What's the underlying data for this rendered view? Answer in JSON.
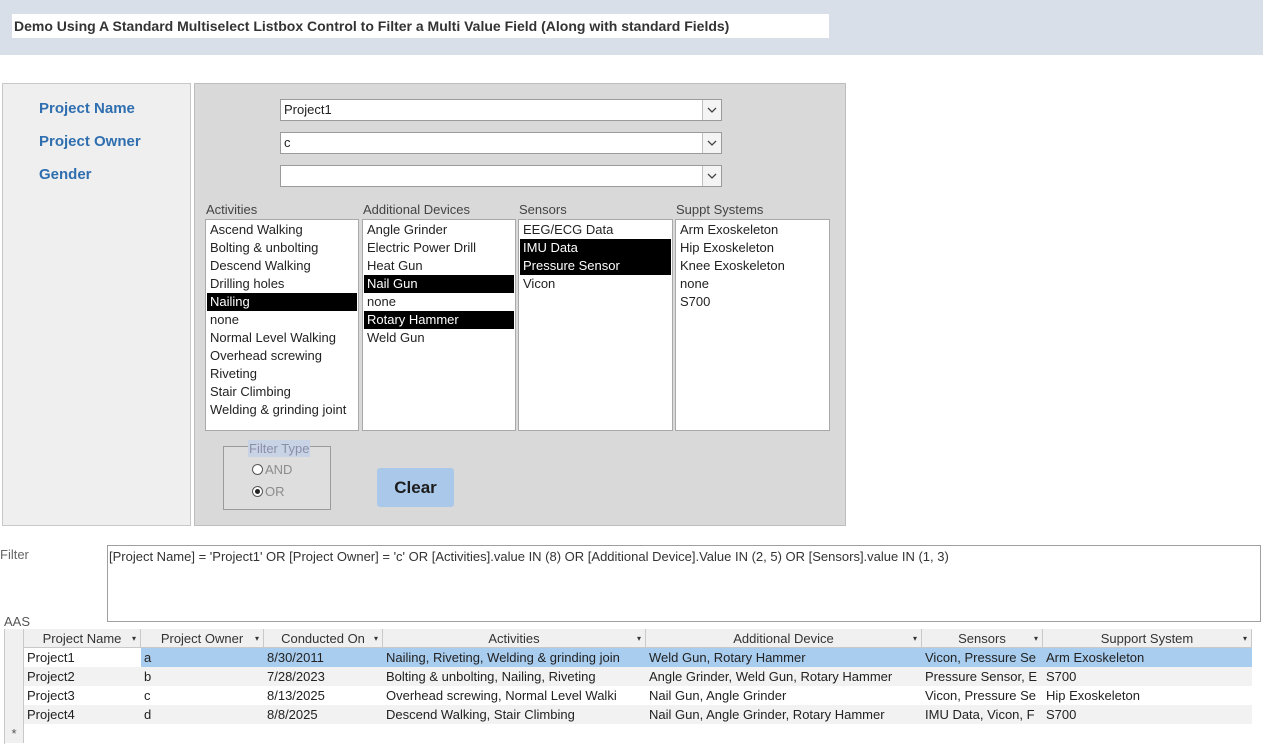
{
  "page_title": "Demo Using A Standard Multiselect Listbox Control to Filter a Multi Value Field (Along with standard Fields)",
  "fields": {
    "project_name_label": "Project Name",
    "project_owner_label": "Project Owner",
    "gender_label": "Gender",
    "project_name_value": "Project1",
    "project_owner_value": "c",
    "gender_value": ""
  },
  "lists": {
    "activities": {
      "caption": "Activities",
      "items": [
        "Ascend Walking",
        "Bolting & unbolting",
        "Descend Walking",
        "Drilling holes",
        "Nailing",
        "none",
        "Normal Level Walking",
        "Overhead screwing",
        "Riveting",
        "Stair Climbing",
        "Welding & grinding joint"
      ],
      "selected": [
        4
      ]
    },
    "devices": {
      "caption": "Additional Devices",
      "items": [
        "Angle Grinder",
        "Electric Power Drill",
        "Heat Gun",
        "Nail Gun",
        "none",
        "Rotary Hammer",
        "Weld Gun"
      ],
      "selected": [
        3,
        5
      ]
    },
    "sensors": {
      "caption": "Sensors",
      "items": [
        "EEG/ECG Data",
        "IMU Data",
        "Pressure Sensor",
        "Vicon"
      ],
      "selected": [
        1,
        2
      ]
    },
    "support": {
      "caption": "Suppt Systems",
      "items": [
        "Arm Exoskeleton",
        "Hip Exoskeleton",
        "Knee Exoskeleton",
        "none",
        "S700"
      ],
      "selected": []
    }
  },
  "filter_type": {
    "legend": "Filter Type",
    "and_label": "AND",
    "or_label": "OR",
    "selected": "OR"
  },
  "clear_label": "Clear",
  "filter": {
    "label": "Filter",
    "text": "[Project Name] = 'Project1' OR [Project Owner] = 'c' OR [Activities].value IN (8) OR [Additional Device].Value IN (2, 5) OR [Sensors].value IN (1, 3)"
  },
  "grid": {
    "label": "AAS",
    "columns": [
      "Project Name",
      "Project Owner",
      "Conducted On",
      "Activities",
      "Additional Device",
      "Sensors",
      "Support System"
    ],
    "rows": [
      [
        "Project1",
        "a",
        "8/30/2011",
        "Nailing, Riveting, Welding & grinding join",
        "Weld Gun, Rotary Hammer",
        "Vicon, Pressure Se",
        "Arm Exoskeleton"
      ],
      [
        "Project2",
        "b",
        "7/28/2023",
        "Bolting & unbolting, Nailing, Riveting",
        "Angle Grinder, Weld Gun, Rotary Hammer",
        "Pressure Sensor, E",
        "S700"
      ],
      [
        "Project3",
        "c",
        "8/13/2025",
        "Overhead screwing, Normal Level Walki",
        "Nail Gun, Angle Grinder",
        "Vicon, Pressure Se",
        "Hip Exoskeleton"
      ],
      [
        "Project4",
        "d",
        "8/8/2025",
        "Descend Walking, Stair Climbing",
        "Nail Gun, Angle Grinder, Rotary Hammer",
        "IMU Data, Vicon, F",
        "S700"
      ]
    ],
    "new_row_marker": "*"
  },
  "colors": {
    "header_band": "#d9dfe8",
    "label_blue": "#2f6fb0",
    "selected_item": "#000000",
    "current_row": "#a9cdef",
    "clear_button": "#a9c8ea"
  }
}
